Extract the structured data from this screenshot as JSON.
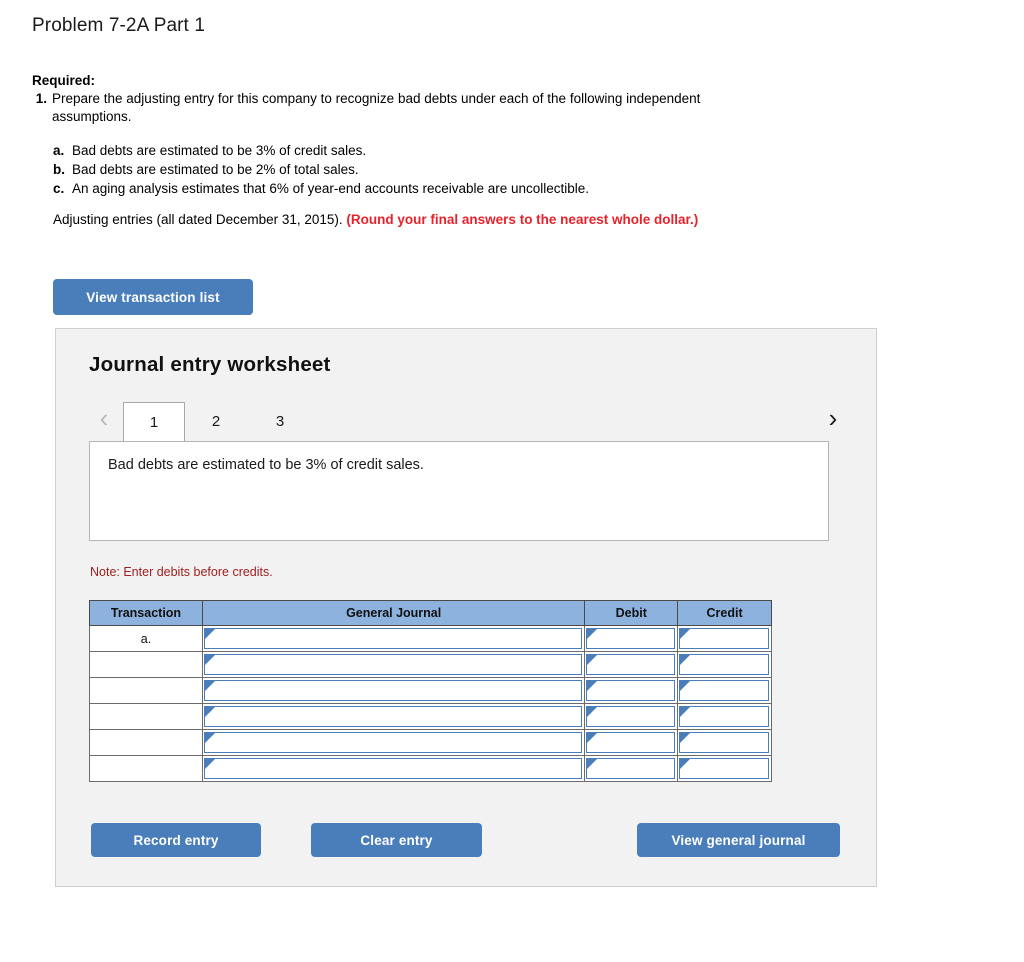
{
  "page_title": "Problem 7-2A Part 1",
  "required": {
    "label": "Required:",
    "items": [
      {
        "number": "1.",
        "text": "Prepare the adjusting entry for this company to recognize bad debts under each of the following independent assumptions."
      }
    ]
  },
  "assumptions": [
    {
      "letter": "a.",
      "text": "Bad debts are estimated to be 3% of credit sales."
    },
    {
      "letter": "b.",
      "text": "Bad debts are estimated to be 2% of total sales."
    },
    {
      "letter": "c.",
      "text": "An aging analysis estimates that 6% of year-end accounts receivable are uncollectible."
    }
  ],
  "adjusting_note": {
    "plain": "Adjusting entries (all dated December 31, 2015). ",
    "emphasis": "(Round your final answers to the nearest whole dollar.)"
  },
  "view_transaction_list_label": "View transaction list",
  "worksheet": {
    "title": "Journal entry worksheet",
    "prev_icon": "chevron-left-icon",
    "next_icon": "chevron-right-icon",
    "prev_glyph": "‹",
    "next_glyph": "›",
    "tabs": [
      {
        "label": "1",
        "active": true
      },
      {
        "label": "2",
        "active": false
      },
      {
        "label": "3",
        "active": false
      }
    ],
    "question_text": "Bad debts are estimated to be 3% of credit sales.",
    "note": "Note: Enter debits before credits.",
    "table": {
      "headers": [
        "Transaction",
        "General Journal",
        "Debit",
        "Credit"
      ],
      "rows": [
        {
          "transaction": "a.",
          "general_journal": "",
          "debit": "",
          "credit": ""
        },
        {
          "transaction": "",
          "general_journal": "",
          "debit": "",
          "credit": ""
        },
        {
          "transaction": "",
          "general_journal": "",
          "debit": "",
          "credit": ""
        },
        {
          "transaction": "",
          "general_journal": "",
          "debit": "",
          "credit": ""
        },
        {
          "transaction": "",
          "general_journal": "",
          "debit": "",
          "credit": ""
        },
        {
          "transaction": "",
          "general_journal": "",
          "debit": "",
          "credit": ""
        }
      ]
    },
    "buttons": {
      "record_entry": "Record entry",
      "clear_entry": "Clear entry",
      "view_general_journal": "View general journal"
    }
  },
  "colors": {
    "button_blue": "#4a7ebb",
    "header_blue": "#8db2de",
    "note_red": "#a02020",
    "emphasis_red": "#e8222a",
    "panel_bg": "#f2f2f2"
  }
}
